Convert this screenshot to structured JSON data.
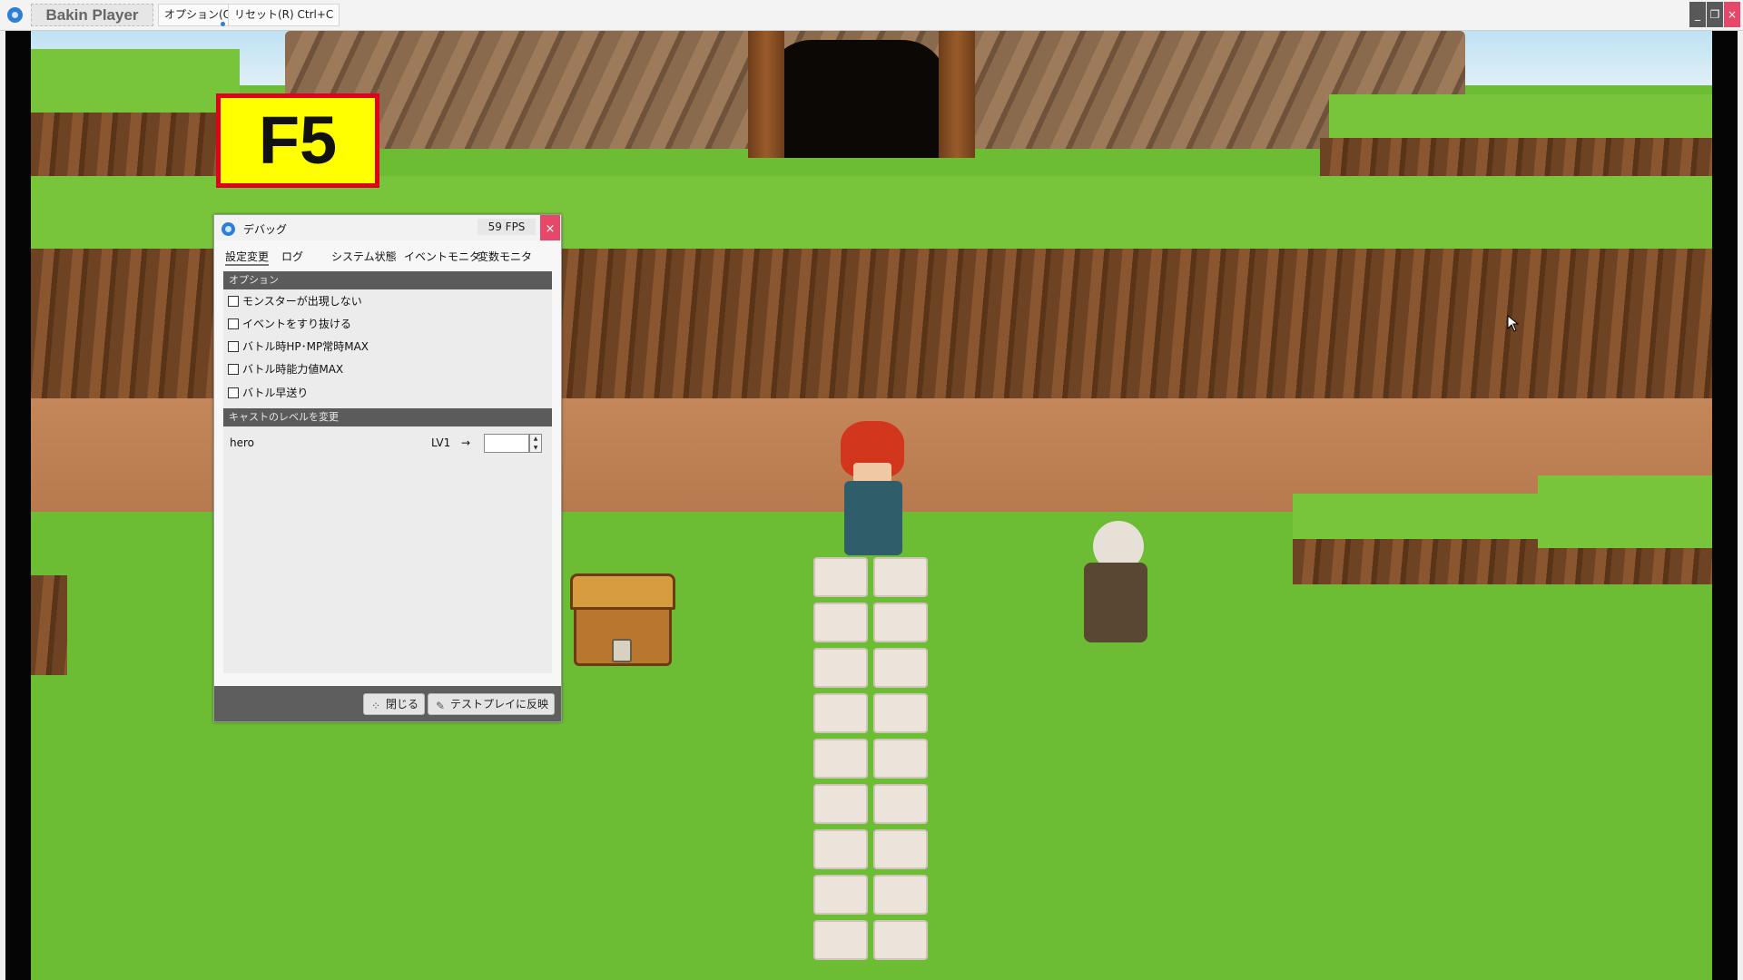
{
  "window": {
    "app_title": "Bakin Player",
    "menu_option": "オプション(O)",
    "menu_reset": "リセット(R) Ctrl+C",
    "minimize_glyph": "_",
    "restore_glyph": "❐",
    "close_glyph": "×"
  },
  "overlay": {
    "key_badge": "F5",
    "key_badge_colors": {
      "background": "#ffff00",
      "border": "#e0001a"
    }
  },
  "debug": {
    "title": "デバッグ",
    "fps": "59 FPS",
    "close_glyph": "×",
    "tabs": [
      "設定変更",
      "ログ",
      "システム状態",
      "イベントモニタ",
      "変数モニタ"
    ],
    "active_tab": "設定変更",
    "options_header": "オプション",
    "options": [
      {
        "label": "モンスターが出現しない",
        "checked": false
      },
      {
        "label": "イベントをすり抜ける",
        "checked": false
      },
      {
        "label": "バトル時HP･MP常時MAX",
        "checked": false
      },
      {
        "label": "バトル時能力値MAX",
        "checked": false
      },
      {
        "label": "バトル早送り",
        "checked": false
      }
    ],
    "level_header": "キャストのレベルを変更",
    "cast": [
      {
        "name": "hero",
        "current": "LV1",
        "arrow": "→",
        "new_value": ""
      }
    ],
    "buttons": {
      "close": "閉じる",
      "apply": "テストプレイに反映"
    }
  },
  "scene": {
    "colors": {
      "grass": "#6cbd34",
      "cliff": "#6d4323",
      "dirt": "#c4875a",
      "path_tile": "#ece4da"
    }
  }
}
